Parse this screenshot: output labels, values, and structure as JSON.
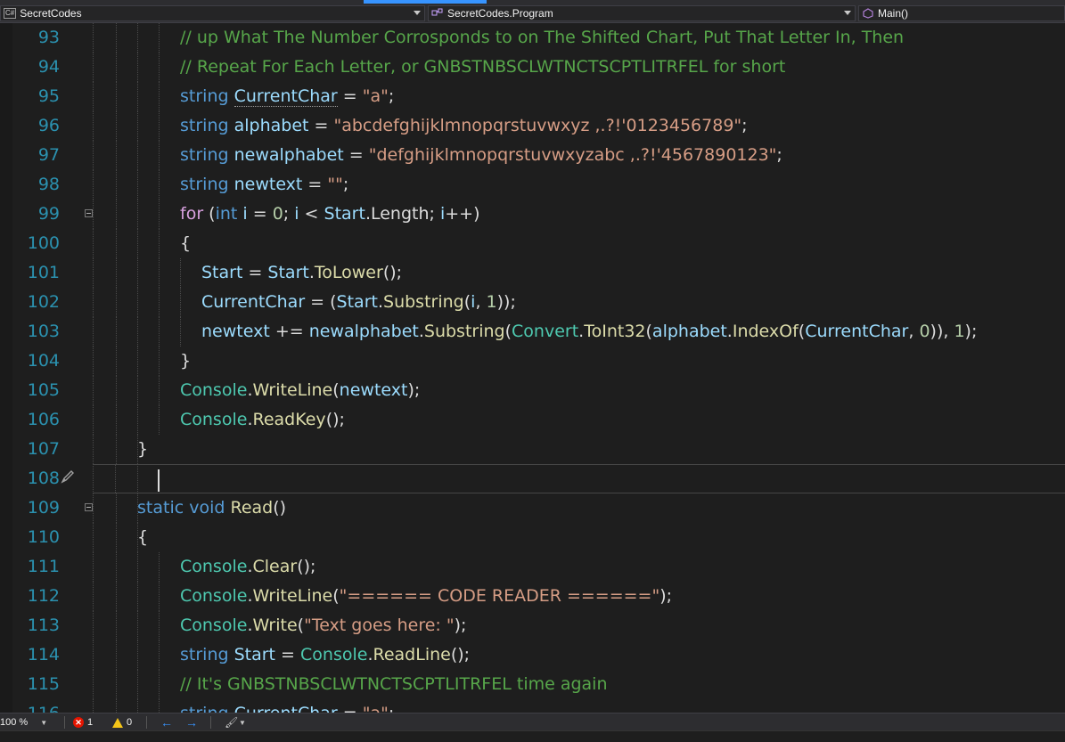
{
  "navbar": {
    "project": "SecretCodes",
    "project_icon": "C#",
    "class": "SecretCodes.Program",
    "member": "Main()"
  },
  "editor": {
    "lines": [
      {
        "n": "93",
        "indent": 2,
        "tokens": [
          [
            "com",
            "// up What The Number Corrosponds to on The Shifted Chart, Put That Letter In, Then"
          ]
        ]
      },
      {
        "n": "94",
        "indent": 2,
        "tokens": [
          [
            "com",
            "// Repeat For Each Letter, or GNBSTNBSCLWTNCTSCPTLITRFEL for short"
          ]
        ]
      },
      {
        "n": "95",
        "indent": 2,
        "tokens": [
          [
            "kw",
            "string "
          ],
          [
            "var-u",
            "CurrentChar"
          ],
          [
            "pl",
            " = "
          ],
          [
            "str",
            "\"a\""
          ],
          [
            "pl",
            ";"
          ]
        ]
      },
      {
        "n": "96",
        "indent": 2,
        "tokens": [
          [
            "kw",
            "string "
          ],
          [
            "var",
            "alphabet"
          ],
          [
            "pl",
            " = "
          ],
          [
            "str",
            "\"abcdefghijklmnopqrstuvwxyz ,.?!'0123456789\""
          ],
          [
            "pl",
            ";"
          ]
        ]
      },
      {
        "n": "97",
        "indent": 2,
        "tokens": [
          [
            "kw",
            "string "
          ],
          [
            "var",
            "newalphabet"
          ],
          [
            "pl",
            " = "
          ],
          [
            "str",
            "\"defghijklmnopqrstuvwxyzabc ,.?!'4567890123\""
          ],
          [
            "pl",
            ";"
          ]
        ]
      },
      {
        "n": "98",
        "indent": 2,
        "tokens": [
          [
            "kw",
            "string "
          ],
          [
            "var",
            "newtext"
          ],
          [
            "pl",
            " = "
          ],
          [
            "str",
            "\"\""
          ],
          [
            "pl",
            ";"
          ]
        ]
      },
      {
        "n": "99",
        "indent": 2,
        "fold": true,
        "tokens": [
          [
            "kw2",
            "for"
          ],
          [
            "pl",
            " ("
          ],
          [
            "kw",
            "int"
          ],
          [
            "pl",
            " "
          ],
          [
            "var",
            "i"
          ],
          [
            "pl",
            " = "
          ],
          [
            "num",
            "0"
          ],
          [
            "pl",
            "; "
          ],
          [
            "var",
            "i"
          ],
          [
            "pl",
            " < "
          ],
          [
            "var",
            "Start"
          ],
          [
            "pl",
            "."
          ],
          [
            "pl",
            "Length"
          ],
          [
            "pl",
            "; "
          ],
          [
            "var",
            "i"
          ],
          [
            "pl",
            "++)"
          ]
        ]
      },
      {
        "n": "100",
        "indent": 2,
        "tokens": [
          [
            "pl",
            "{"
          ]
        ]
      },
      {
        "n": "101",
        "indent": 3,
        "tokens": [
          [
            "var",
            "Start"
          ],
          [
            "pl",
            " = "
          ],
          [
            "var",
            "Start"
          ],
          [
            "pl",
            "."
          ],
          [
            "mth",
            "ToLower"
          ],
          [
            "pl",
            "();"
          ]
        ]
      },
      {
        "n": "102",
        "indent": 3,
        "tokens": [
          [
            "var",
            "CurrentChar"
          ],
          [
            "pl",
            " = ("
          ],
          [
            "var",
            "Start"
          ],
          [
            "pl",
            "."
          ],
          [
            "mth",
            "Substring"
          ],
          [
            "pl",
            "("
          ],
          [
            "var",
            "i"
          ],
          [
            "pl",
            ", "
          ],
          [
            "num",
            "1"
          ],
          [
            "pl",
            "));"
          ]
        ]
      },
      {
        "n": "103",
        "indent": 3,
        "tokens": [
          [
            "var",
            "newtext"
          ],
          [
            "pl",
            " += "
          ],
          [
            "var",
            "newalphabet"
          ],
          [
            "pl",
            "."
          ],
          [
            "mth",
            "Substring"
          ],
          [
            "pl",
            "("
          ],
          [
            "ty",
            "Convert"
          ],
          [
            "pl",
            "."
          ],
          [
            "mth",
            "ToInt32"
          ],
          [
            "pl",
            "("
          ],
          [
            "var",
            "alphabet"
          ],
          [
            "pl",
            "."
          ],
          [
            "mth",
            "IndexOf"
          ],
          [
            "pl",
            "("
          ],
          [
            "var",
            "CurrentChar"
          ],
          [
            "pl",
            ", "
          ],
          [
            "num",
            "0"
          ],
          [
            "pl",
            ")), "
          ],
          [
            "num",
            "1"
          ],
          [
            "pl",
            ");"
          ]
        ]
      },
      {
        "n": "104",
        "indent": 2,
        "tokens": [
          [
            "pl",
            "}"
          ]
        ]
      },
      {
        "n": "105",
        "indent": 2,
        "tokens": [
          [
            "ty",
            "Console"
          ],
          [
            "pl",
            "."
          ],
          [
            "mth",
            "WriteLine"
          ],
          [
            "pl",
            "("
          ],
          [
            "var",
            "newtext"
          ],
          [
            "pl",
            ");"
          ]
        ]
      },
      {
        "n": "106",
        "indent": 2,
        "tokens": [
          [
            "ty",
            "Console"
          ],
          [
            "pl",
            "."
          ],
          [
            "mth",
            "ReadKey"
          ],
          [
            "pl",
            "();"
          ]
        ]
      },
      {
        "n": "107",
        "indent": 1,
        "tokens": [
          [
            "pl",
            "}"
          ]
        ]
      },
      {
        "n": "108",
        "indent": 1,
        "current": true,
        "tokens": []
      },
      {
        "n": "109",
        "indent": 1,
        "fold": true,
        "tokens": [
          [
            "kw",
            "static void "
          ],
          [
            "mth",
            "Read"
          ],
          [
            "pl",
            "()"
          ]
        ]
      },
      {
        "n": "110",
        "indent": 1,
        "tokens": [
          [
            "pl",
            "{"
          ]
        ]
      },
      {
        "n": "111",
        "indent": 2,
        "tokens": [
          [
            "ty",
            "Console"
          ],
          [
            "pl",
            "."
          ],
          [
            "mth",
            "Clear"
          ],
          [
            "pl",
            "();"
          ]
        ]
      },
      {
        "n": "112",
        "indent": 2,
        "tokens": [
          [
            "ty",
            "Console"
          ],
          [
            "pl",
            "."
          ],
          [
            "mth",
            "WriteLine"
          ],
          [
            "pl",
            "("
          ],
          [
            "str",
            "\"====== CODE READER ======\""
          ],
          [
            "pl",
            ");"
          ]
        ]
      },
      {
        "n": "113",
        "indent": 2,
        "tokens": [
          [
            "ty",
            "Console"
          ],
          [
            "pl",
            "."
          ],
          [
            "mth",
            "Write"
          ],
          [
            "pl",
            "("
          ],
          [
            "str",
            "\"Text goes here: \""
          ],
          [
            "pl",
            ");"
          ]
        ]
      },
      {
        "n": "114",
        "indent": 2,
        "tokens": [
          [
            "kw",
            "string "
          ],
          [
            "var",
            "Start"
          ],
          [
            "pl",
            " = "
          ],
          [
            "ty",
            "Console"
          ],
          [
            "pl",
            "."
          ],
          [
            "mth",
            "ReadLine"
          ],
          [
            "pl",
            "();"
          ]
        ]
      },
      {
        "n": "115",
        "indent": 2,
        "tokens": [
          [
            "com",
            "// It's GNBSTNBSCLWTNCTSCPTLITRFEL time again"
          ]
        ]
      },
      {
        "n": "116",
        "indent": 2,
        "tokens": [
          [
            "kw",
            "string "
          ],
          [
            "var",
            "CurrentChar"
          ],
          [
            "pl",
            " = "
          ],
          [
            "str",
            "\"a\""
          ],
          [
            "pl",
            ";"
          ]
        ]
      }
    ]
  },
  "statusbar": {
    "zoom": "100 %",
    "errors": "1",
    "warnings": "0"
  },
  "colors": {
    "keyword": "#569cd6",
    "control": "#d8a0df",
    "type": "#4ec9b0",
    "string": "#d69d85",
    "comment": "#57a64a",
    "number": "#b5cea8",
    "method": "#dcdcaa",
    "variable": "#9cdcfe",
    "line_number": "#2b91af"
  }
}
